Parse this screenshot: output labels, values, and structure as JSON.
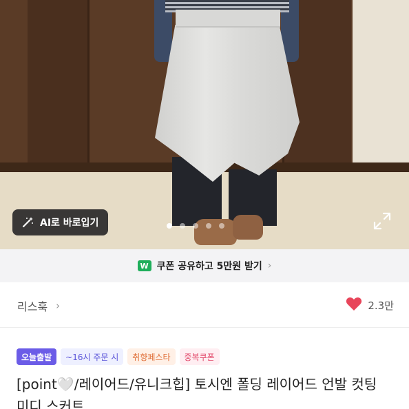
{
  "photo": {
    "ai_button_label": "AI로 바로입기",
    "image_count": 5,
    "active_index": 0
  },
  "coupon": {
    "icon_text": "W",
    "text": "쿠폰 공유하고 5만원 받기",
    "icon_color": "#1fae5b"
  },
  "seller": {
    "name": "리스훅",
    "like_count": "2.3만",
    "heart_color": "#e8455a"
  },
  "badges": {
    "today": "오늘출발",
    "time": "~16시 주문 시",
    "taste": "취향페스타",
    "dup": "중복쿠폰"
  },
  "product": {
    "title": "[point🤍/레이어드/유니크힙] 토시엔 폴딩 레이어드 언발 컷팅 미디 스커트"
  }
}
